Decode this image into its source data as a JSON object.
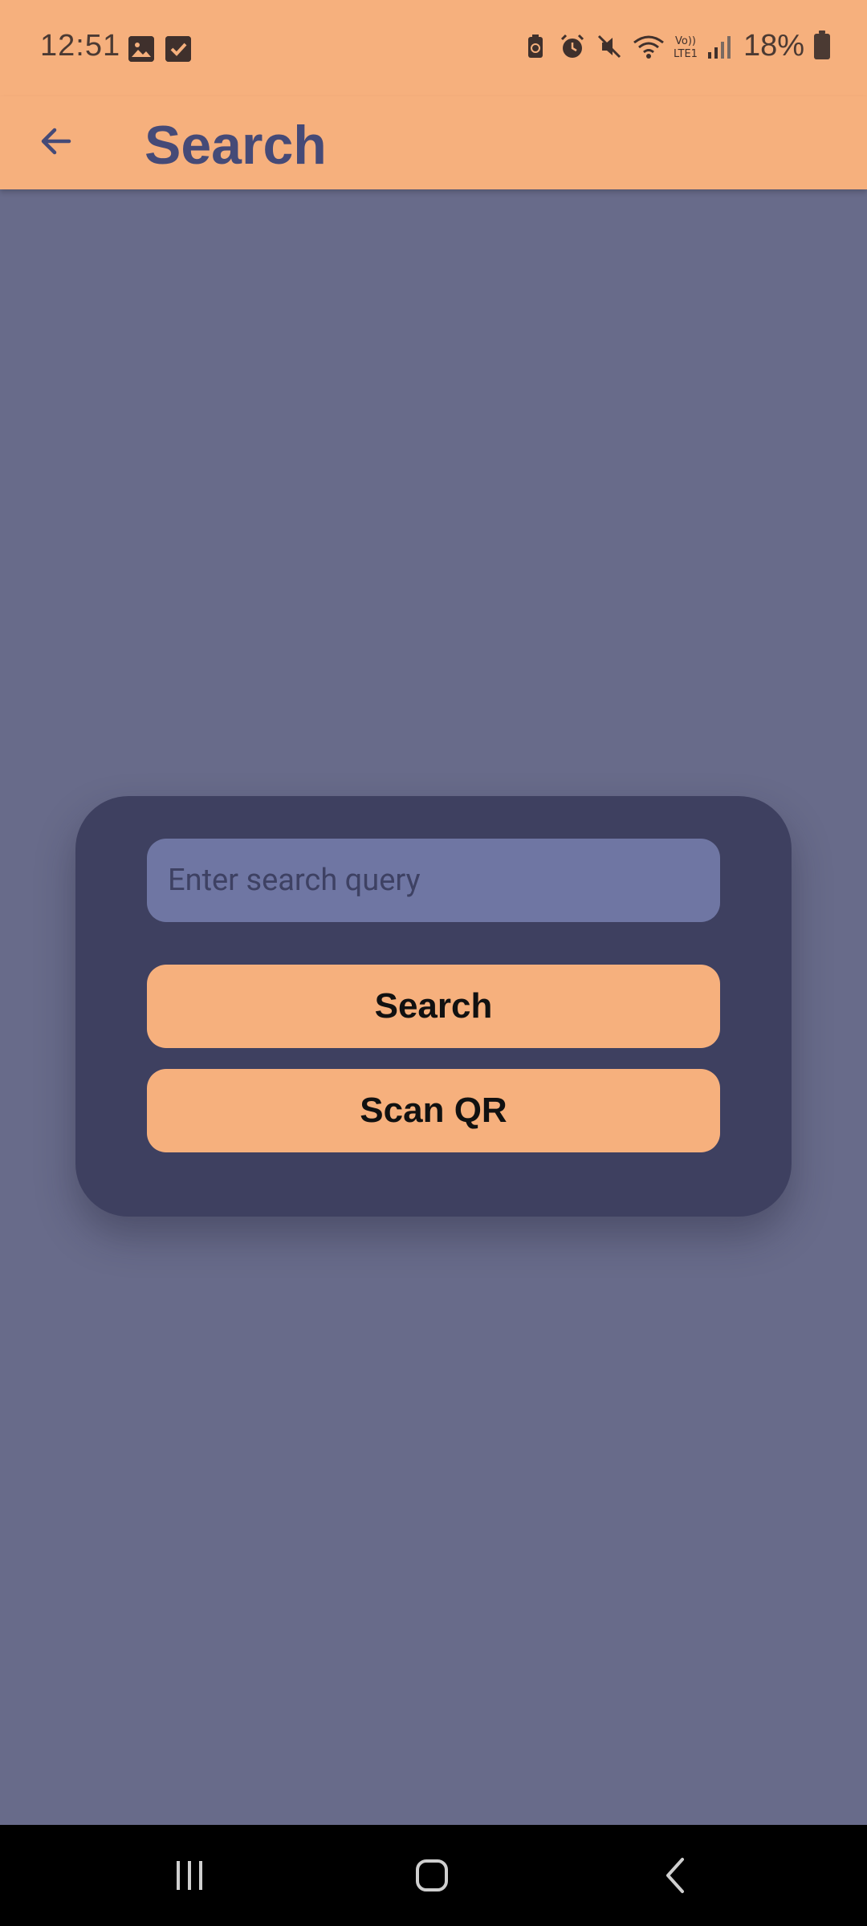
{
  "status_bar": {
    "time": "12:51",
    "battery_text": "18%",
    "left_icons": [
      "gallery-icon",
      "checkbox-icon"
    ],
    "right_icons": [
      "battery-saver-icon",
      "alarm-icon",
      "mute-icon",
      "wifi-icon",
      "volte-icon",
      "signal-icon",
      "battery-icon"
    ]
  },
  "app_bar": {
    "title": "Search",
    "back_icon": "arrow-back-icon"
  },
  "card": {
    "search_placeholder": "Enter search query",
    "search_value": "",
    "search_button_label": "Search",
    "scan_button_label": "Scan QR"
  },
  "nav_bar": {
    "items": [
      "recents-icon",
      "home-icon",
      "back-icon"
    ]
  },
  "colors": {
    "accent": "#f6b07d",
    "background": "#686b8a",
    "card": "#3e4060",
    "input": "#6f76a3",
    "title": "#454a77"
  }
}
